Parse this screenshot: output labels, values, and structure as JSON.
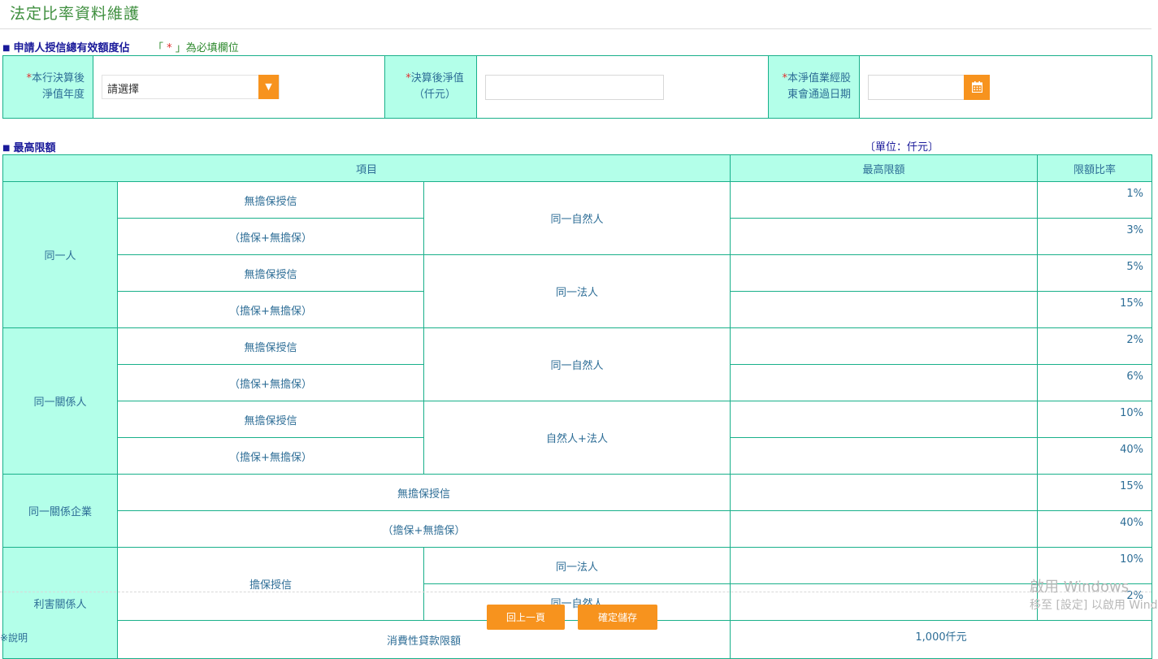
{
  "page": {
    "title": "法定比率資料維護"
  },
  "section1": {
    "title": "申請人授信總有效額度佔",
    "note_pre": "「",
    "note_star": " * ",
    "note_post": "」為必填欄位"
  },
  "form": {
    "field1": {
      "label_star": "*",
      "label": "本行決算後淨值年度",
      "select_value": "請選擇",
      "select_arrow": "▼"
    },
    "field2": {
      "label_star": "*",
      "label": "決算後淨值（仟元）",
      "value": ""
    },
    "field3": {
      "label_star": "*",
      "label": "本淨值業經股東會通過日期",
      "value": ""
    }
  },
  "section2": {
    "title": "最高限額",
    "unit": "〔單位：仟元〕"
  },
  "table": {
    "headers": {
      "item": "項目",
      "max": "最高限額",
      "ratio": "限額比率"
    },
    "groups": {
      "same_person": "同一人",
      "same_related": "同一關係人",
      "same_enterprise": "同一關係企業",
      "interested": "利害關係人"
    },
    "labels": {
      "unsecured": "無擔保授信",
      "combined": "（擔保+無擔保）",
      "secured": "擔保授信",
      "natural": "同一自然人",
      "legal": "同一法人",
      "natural_legal": "自然人+法人"
    },
    "rates": [
      "1%",
      "3%",
      "5%",
      "15%",
      "2%",
      "6%",
      "10%",
      "40%",
      "15%",
      "40%",
      "10%",
      "2%"
    ],
    "consumer": {
      "label": "消費性貸款限額",
      "value": "1,000仟元"
    }
  },
  "buttons": {
    "back": "回上一頁",
    "save": "確定儲存"
  },
  "footer_cut": "※說明",
  "watermark": {
    "line1": "啟用 Windows",
    "line2": "移至 [設定] 以啟用 Windows"
  }
}
